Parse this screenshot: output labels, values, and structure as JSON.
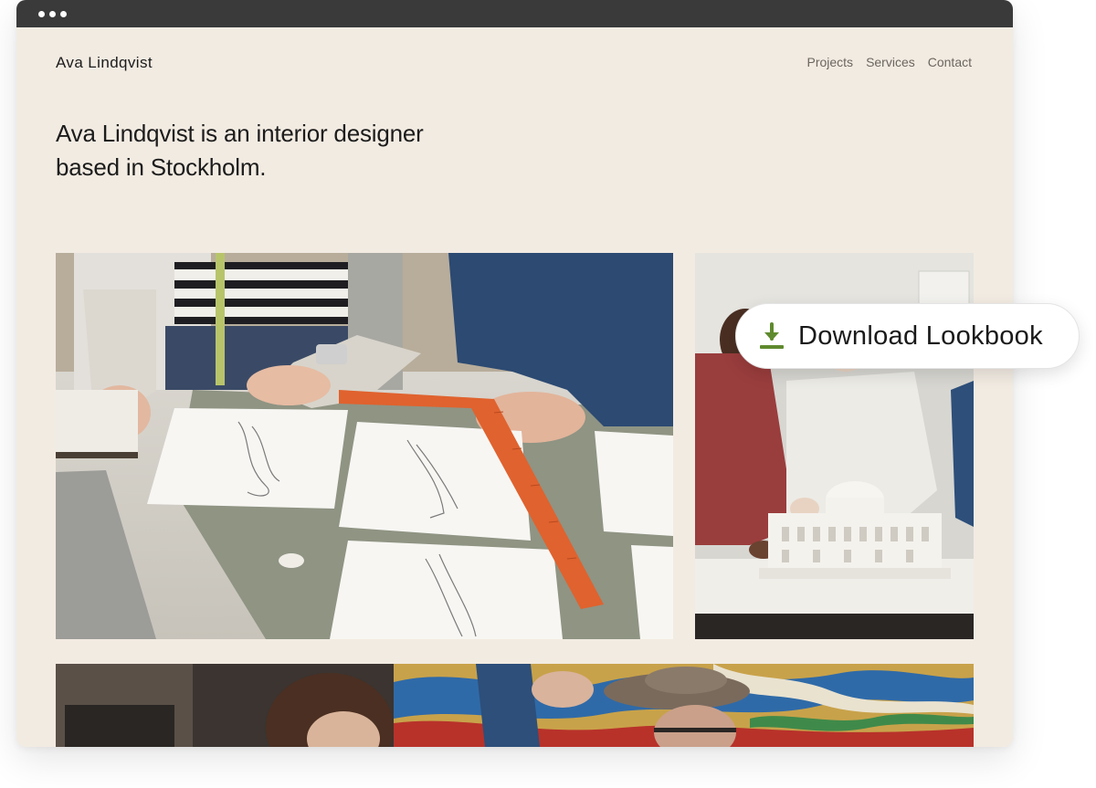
{
  "site": {
    "brand": "Ava Lindqvist",
    "nav": [
      "Projects",
      "Services",
      "Contact"
    ],
    "headline_line1": "Ava Lindqvist is an interior designer",
    "headline_line2": "based in Stockholm."
  },
  "cta": {
    "label": "Download Lookbook",
    "icon": "download-icon",
    "accent_color": "#5f8a2e"
  },
  "theme": {
    "background": "#f2ebe2",
    "titlebar": "#3a3a3a"
  }
}
